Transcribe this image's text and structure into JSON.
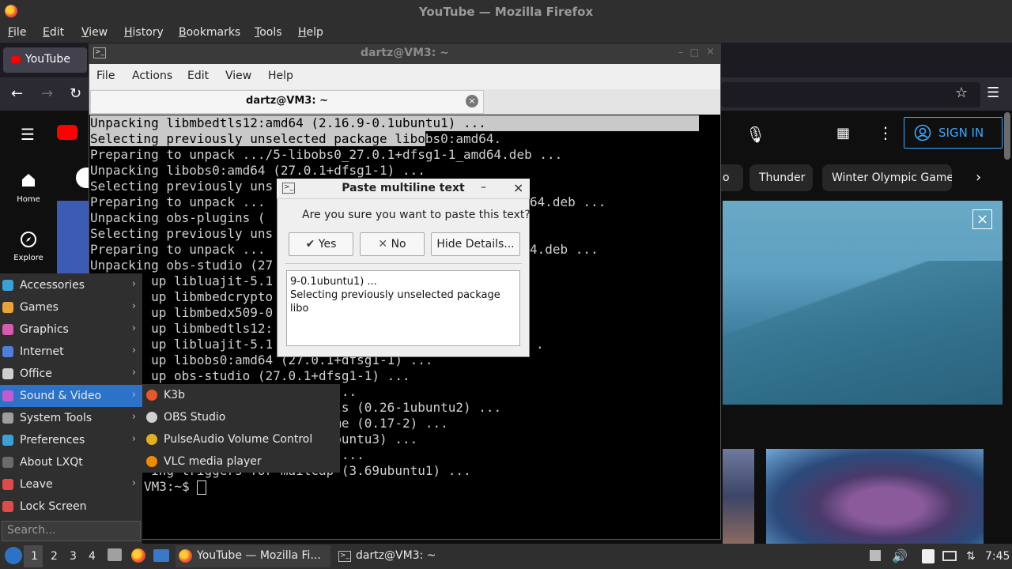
{
  "firefox": {
    "window_title": "YouTube — Mozilla Firefox",
    "menu": [
      "File",
      "Edit",
      "View",
      "History",
      "Bookmarks",
      "Tools",
      "Help"
    ],
    "tab_label": "YouTube"
  },
  "youtube": {
    "sidebar": [
      {
        "label": "Home",
        "icon": "home-icon"
      },
      {
        "label": "Explore",
        "icon": "compass-icon"
      }
    ],
    "sign_in": "SIGN IN",
    "chips": [
      "o",
      "Thunder",
      "Winter Olympic Games"
    ]
  },
  "terminal": {
    "window_title": "dartz@VM3: ~",
    "menu": [
      "File",
      "Actions",
      "Edit",
      "View",
      "Help"
    ],
    "tab_title": "dartz@VM3: ~",
    "lines": [
      {
        "sel_full": true,
        "text": "Unpacking libmbedtls12:amd64 (2.16.9-0.1ubuntu1) ..."
      },
      {
        "sel_part": true,
        "selected": "Selecting previously unselected package libo",
        "rest": "bs0:amd64."
      },
      {
        "text": "Preparing to unpack .../5-libobs0_27.0.1+dfsg1-1_amd64.deb ..."
      },
      {
        "text": "Unpacking libobs0:amd64 (27.0.1+dfsg1-1) ..."
      },
      {
        "text": "Selecting previously uns"
      },
      {
        "text": "Preparing to unpack ...",
        "tail": "64.deb ..."
      },
      {
        "text": "Unpacking obs-plugins ("
      },
      {
        "text": "Selecting previously uns"
      },
      {
        "text": "Preparing to unpack ...",
        "tail": "4.deb ..."
      },
      {
        "text": "Unpacking obs-studio (27"
      },
      {
        "text": "        up libluajit-5.1"
      },
      {
        "text": "        up libmbedcrypto"
      },
      {
        "text": "        up libmbedx509-0"
      },
      {
        "text": "        up libmbedtls12:"
      },
      {
        "text": "        up libluajit-5.1",
        "tail": "."
      },
      {
        "text": "        up libobs0:amd64 (27.0.1+dfsg1-1) ..."
      },
      {
        "text": "        up obs-studio (27.0.1+dfsg1-1) ..."
      },
      {
        "text": "                        fsg1-1) ..."
      },
      {
        "text": "                        file-utils (0.26-1ubuntu2) ..."
      },
      {
        "text": "                        icon-theme (0.17-2) ..."
      },
      {
        "text": "                        (2.34-0ubuntu3) ..."
      },
      {
        "text": "                        2.9.4-2) ..."
      },
      {
        "text": "        ing triggers for mailcap (3.69ubuntu1) ..."
      },
      {
        "text": "VM3:~$ "
      }
    ]
  },
  "dialog": {
    "title": "Paste multiline text",
    "question": "Are you sure you want to paste this text?",
    "yes": "Yes",
    "no": "No",
    "details_button": "Hide Details...",
    "details_text": "9-0.1ubuntu1) ...\nSelecting previously unselected package\nlibo"
  },
  "start_menu": {
    "items": [
      {
        "label": "Accessories",
        "submenu": true,
        "color": "#3aa0d8"
      },
      {
        "label": "Games",
        "submenu": true,
        "color": "#e8a33a"
      },
      {
        "label": "Graphics",
        "submenu": true,
        "color": "#d65bb0"
      },
      {
        "label": "Internet",
        "submenu": true,
        "color": "#4f7fd8"
      },
      {
        "label": "Office",
        "submenu": true,
        "color": "#cfcfcf"
      },
      {
        "label": "Sound & Video",
        "submenu": true,
        "color": "#c45ad0"
      },
      {
        "label": "System Tools",
        "submenu": true,
        "color": "#9e9e9e"
      },
      {
        "label": "Preferences",
        "submenu": true,
        "color": "#3aa0d8"
      },
      {
        "label": "About LXQt",
        "submenu": false,
        "color": "#6b6b6b"
      },
      {
        "label": "Leave",
        "submenu": true,
        "color": "#e04a4a"
      },
      {
        "label": "Lock Screen",
        "submenu": false,
        "color": "#e04a4a"
      }
    ],
    "search_placeholder": "Search...",
    "submenu": [
      {
        "label": "K3b",
        "icon": "k3b-icon",
        "color": "#e8562a"
      },
      {
        "label": "OBS Studio",
        "icon": "obs-icon",
        "color": "#cfcfcf"
      },
      {
        "label": "PulseAudio Volume Control",
        "icon": "pulseaudio-icon",
        "color": "#e0b020"
      },
      {
        "label": "VLC media player",
        "icon": "vlc-icon",
        "color": "#f08a00"
      }
    ]
  },
  "taskbar": {
    "workspaces": [
      "1",
      "2",
      "3",
      "4"
    ],
    "tasks": [
      "YouTube — Mozilla Fi...",
      "dartz@VM3: ~"
    ],
    "clock": "7:45"
  },
  "colors": {
    "accent": "#2c72c7",
    "yt_red": "#ff0000",
    "signin_blue": "#3ea6ff"
  }
}
